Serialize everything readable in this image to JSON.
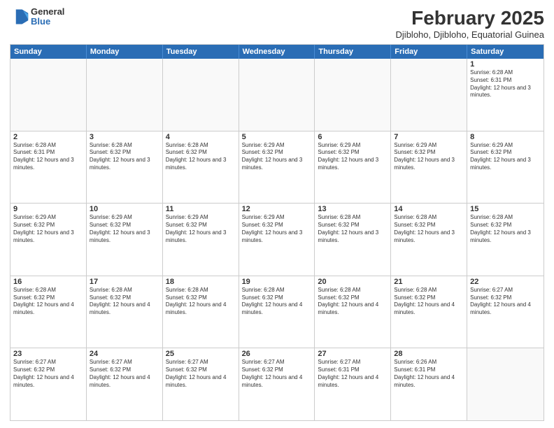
{
  "header": {
    "logo_general": "General",
    "logo_blue": "Blue",
    "main_title": "February 2025",
    "subtitle": "Djibloho, Djibloho, Equatorial Guinea"
  },
  "days_of_week": [
    "Sunday",
    "Monday",
    "Tuesday",
    "Wednesday",
    "Thursday",
    "Friday",
    "Saturday"
  ],
  "rows": [
    [
      {
        "day": "",
        "text": ""
      },
      {
        "day": "",
        "text": ""
      },
      {
        "day": "",
        "text": ""
      },
      {
        "day": "",
        "text": ""
      },
      {
        "day": "",
        "text": ""
      },
      {
        "day": "",
        "text": ""
      },
      {
        "day": "1",
        "text": "Sunrise: 6:28 AM\nSunset: 6:31 PM\nDaylight: 12 hours and 3 minutes."
      }
    ],
    [
      {
        "day": "2",
        "text": "Sunrise: 6:28 AM\nSunset: 6:31 PM\nDaylight: 12 hours and 3 minutes."
      },
      {
        "day": "3",
        "text": "Sunrise: 6:28 AM\nSunset: 6:32 PM\nDaylight: 12 hours and 3 minutes."
      },
      {
        "day": "4",
        "text": "Sunrise: 6:28 AM\nSunset: 6:32 PM\nDaylight: 12 hours and 3 minutes."
      },
      {
        "day": "5",
        "text": "Sunrise: 6:29 AM\nSunset: 6:32 PM\nDaylight: 12 hours and 3 minutes."
      },
      {
        "day": "6",
        "text": "Sunrise: 6:29 AM\nSunset: 6:32 PM\nDaylight: 12 hours and 3 minutes."
      },
      {
        "day": "7",
        "text": "Sunrise: 6:29 AM\nSunset: 6:32 PM\nDaylight: 12 hours and 3 minutes."
      },
      {
        "day": "8",
        "text": "Sunrise: 6:29 AM\nSunset: 6:32 PM\nDaylight: 12 hours and 3 minutes."
      }
    ],
    [
      {
        "day": "9",
        "text": "Sunrise: 6:29 AM\nSunset: 6:32 PM\nDaylight: 12 hours and 3 minutes."
      },
      {
        "day": "10",
        "text": "Sunrise: 6:29 AM\nSunset: 6:32 PM\nDaylight: 12 hours and 3 minutes."
      },
      {
        "day": "11",
        "text": "Sunrise: 6:29 AM\nSunset: 6:32 PM\nDaylight: 12 hours and 3 minutes."
      },
      {
        "day": "12",
        "text": "Sunrise: 6:29 AM\nSunset: 6:32 PM\nDaylight: 12 hours and 3 minutes."
      },
      {
        "day": "13",
        "text": "Sunrise: 6:28 AM\nSunset: 6:32 PM\nDaylight: 12 hours and 3 minutes."
      },
      {
        "day": "14",
        "text": "Sunrise: 6:28 AM\nSunset: 6:32 PM\nDaylight: 12 hours and 3 minutes."
      },
      {
        "day": "15",
        "text": "Sunrise: 6:28 AM\nSunset: 6:32 PM\nDaylight: 12 hours and 3 minutes."
      }
    ],
    [
      {
        "day": "16",
        "text": "Sunrise: 6:28 AM\nSunset: 6:32 PM\nDaylight: 12 hours and 4 minutes."
      },
      {
        "day": "17",
        "text": "Sunrise: 6:28 AM\nSunset: 6:32 PM\nDaylight: 12 hours and 4 minutes."
      },
      {
        "day": "18",
        "text": "Sunrise: 6:28 AM\nSunset: 6:32 PM\nDaylight: 12 hours and 4 minutes."
      },
      {
        "day": "19",
        "text": "Sunrise: 6:28 AM\nSunset: 6:32 PM\nDaylight: 12 hours and 4 minutes."
      },
      {
        "day": "20",
        "text": "Sunrise: 6:28 AM\nSunset: 6:32 PM\nDaylight: 12 hours and 4 minutes."
      },
      {
        "day": "21",
        "text": "Sunrise: 6:28 AM\nSunset: 6:32 PM\nDaylight: 12 hours and 4 minutes."
      },
      {
        "day": "22",
        "text": "Sunrise: 6:27 AM\nSunset: 6:32 PM\nDaylight: 12 hours and 4 minutes."
      }
    ],
    [
      {
        "day": "23",
        "text": "Sunrise: 6:27 AM\nSunset: 6:32 PM\nDaylight: 12 hours and 4 minutes."
      },
      {
        "day": "24",
        "text": "Sunrise: 6:27 AM\nSunset: 6:32 PM\nDaylight: 12 hours and 4 minutes."
      },
      {
        "day": "25",
        "text": "Sunrise: 6:27 AM\nSunset: 6:32 PM\nDaylight: 12 hours and 4 minutes."
      },
      {
        "day": "26",
        "text": "Sunrise: 6:27 AM\nSunset: 6:32 PM\nDaylight: 12 hours and 4 minutes."
      },
      {
        "day": "27",
        "text": "Sunrise: 6:27 AM\nSunset: 6:31 PM\nDaylight: 12 hours and 4 minutes."
      },
      {
        "day": "28",
        "text": "Sunrise: 6:26 AM\nSunset: 6:31 PM\nDaylight: 12 hours and 4 minutes."
      },
      {
        "day": "",
        "text": ""
      }
    ]
  ]
}
